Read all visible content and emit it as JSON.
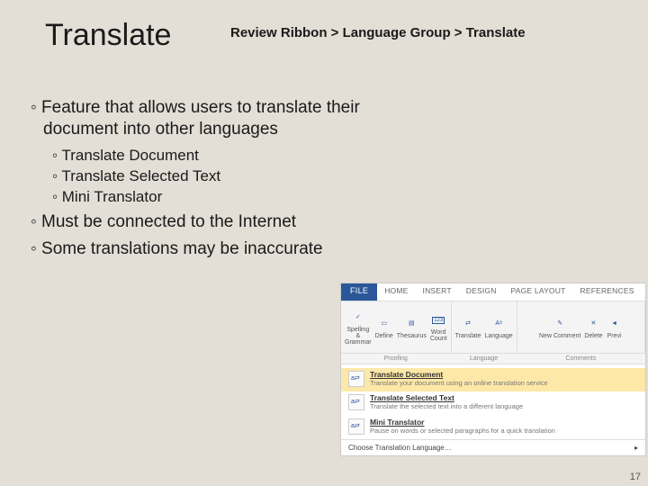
{
  "title": "Translate",
  "breadcrumb": "Review Ribbon > Language Group > Translate",
  "bullets": [
    {
      "text": "Feature that allows users to translate their document into other languages",
      "sub": [
        "Translate Document",
        "Translate Selected Text",
        "Mini Translator"
      ]
    },
    {
      "text": "Must be connected to the Internet"
    },
    {
      "text": "Some translations may be inaccurate"
    }
  ],
  "ribbon": {
    "tabs": [
      "FILE",
      "HOME",
      "INSERT",
      "DESIGN",
      "PAGE LAYOUT",
      "REFERENCES"
    ],
    "groups": {
      "proofing": {
        "label": "Proofing",
        "items": [
          {
            "name": "spelling",
            "label": "Spelling & Grammar"
          },
          {
            "name": "define",
            "label": "Define"
          },
          {
            "name": "thesaurus",
            "label": "Thesaurus"
          },
          {
            "name": "wordcount",
            "label": "Word Count"
          }
        ]
      },
      "language": {
        "label": "Language",
        "items": [
          {
            "name": "translate",
            "label": "Translate"
          },
          {
            "name": "language",
            "label": "Language"
          }
        ]
      },
      "comments": {
        "label": "Comments",
        "items": [
          {
            "name": "new",
            "label": "New Comment"
          },
          {
            "name": "delete",
            "label": "Delete"
          },
          {
            "name": "previous",
            "label": "Previ"
          }
        ]
      }
    },
    "dropdown": [
      {
        "title": "Translate Document",
        "desc": "Translate your document using an online translation service"
      },
      {
        "title": "Translate Selected Text",
        "desc": "Translate the selected text into a different language"
      },
      {
        "title": "Mini Translator",
        "desc": "Pause on words or selected paragraphs for a quick translation"
      }
    ],
    "dropdown_footer": "Choose Translation Language…"
  },
  "page_number": "17"
}
